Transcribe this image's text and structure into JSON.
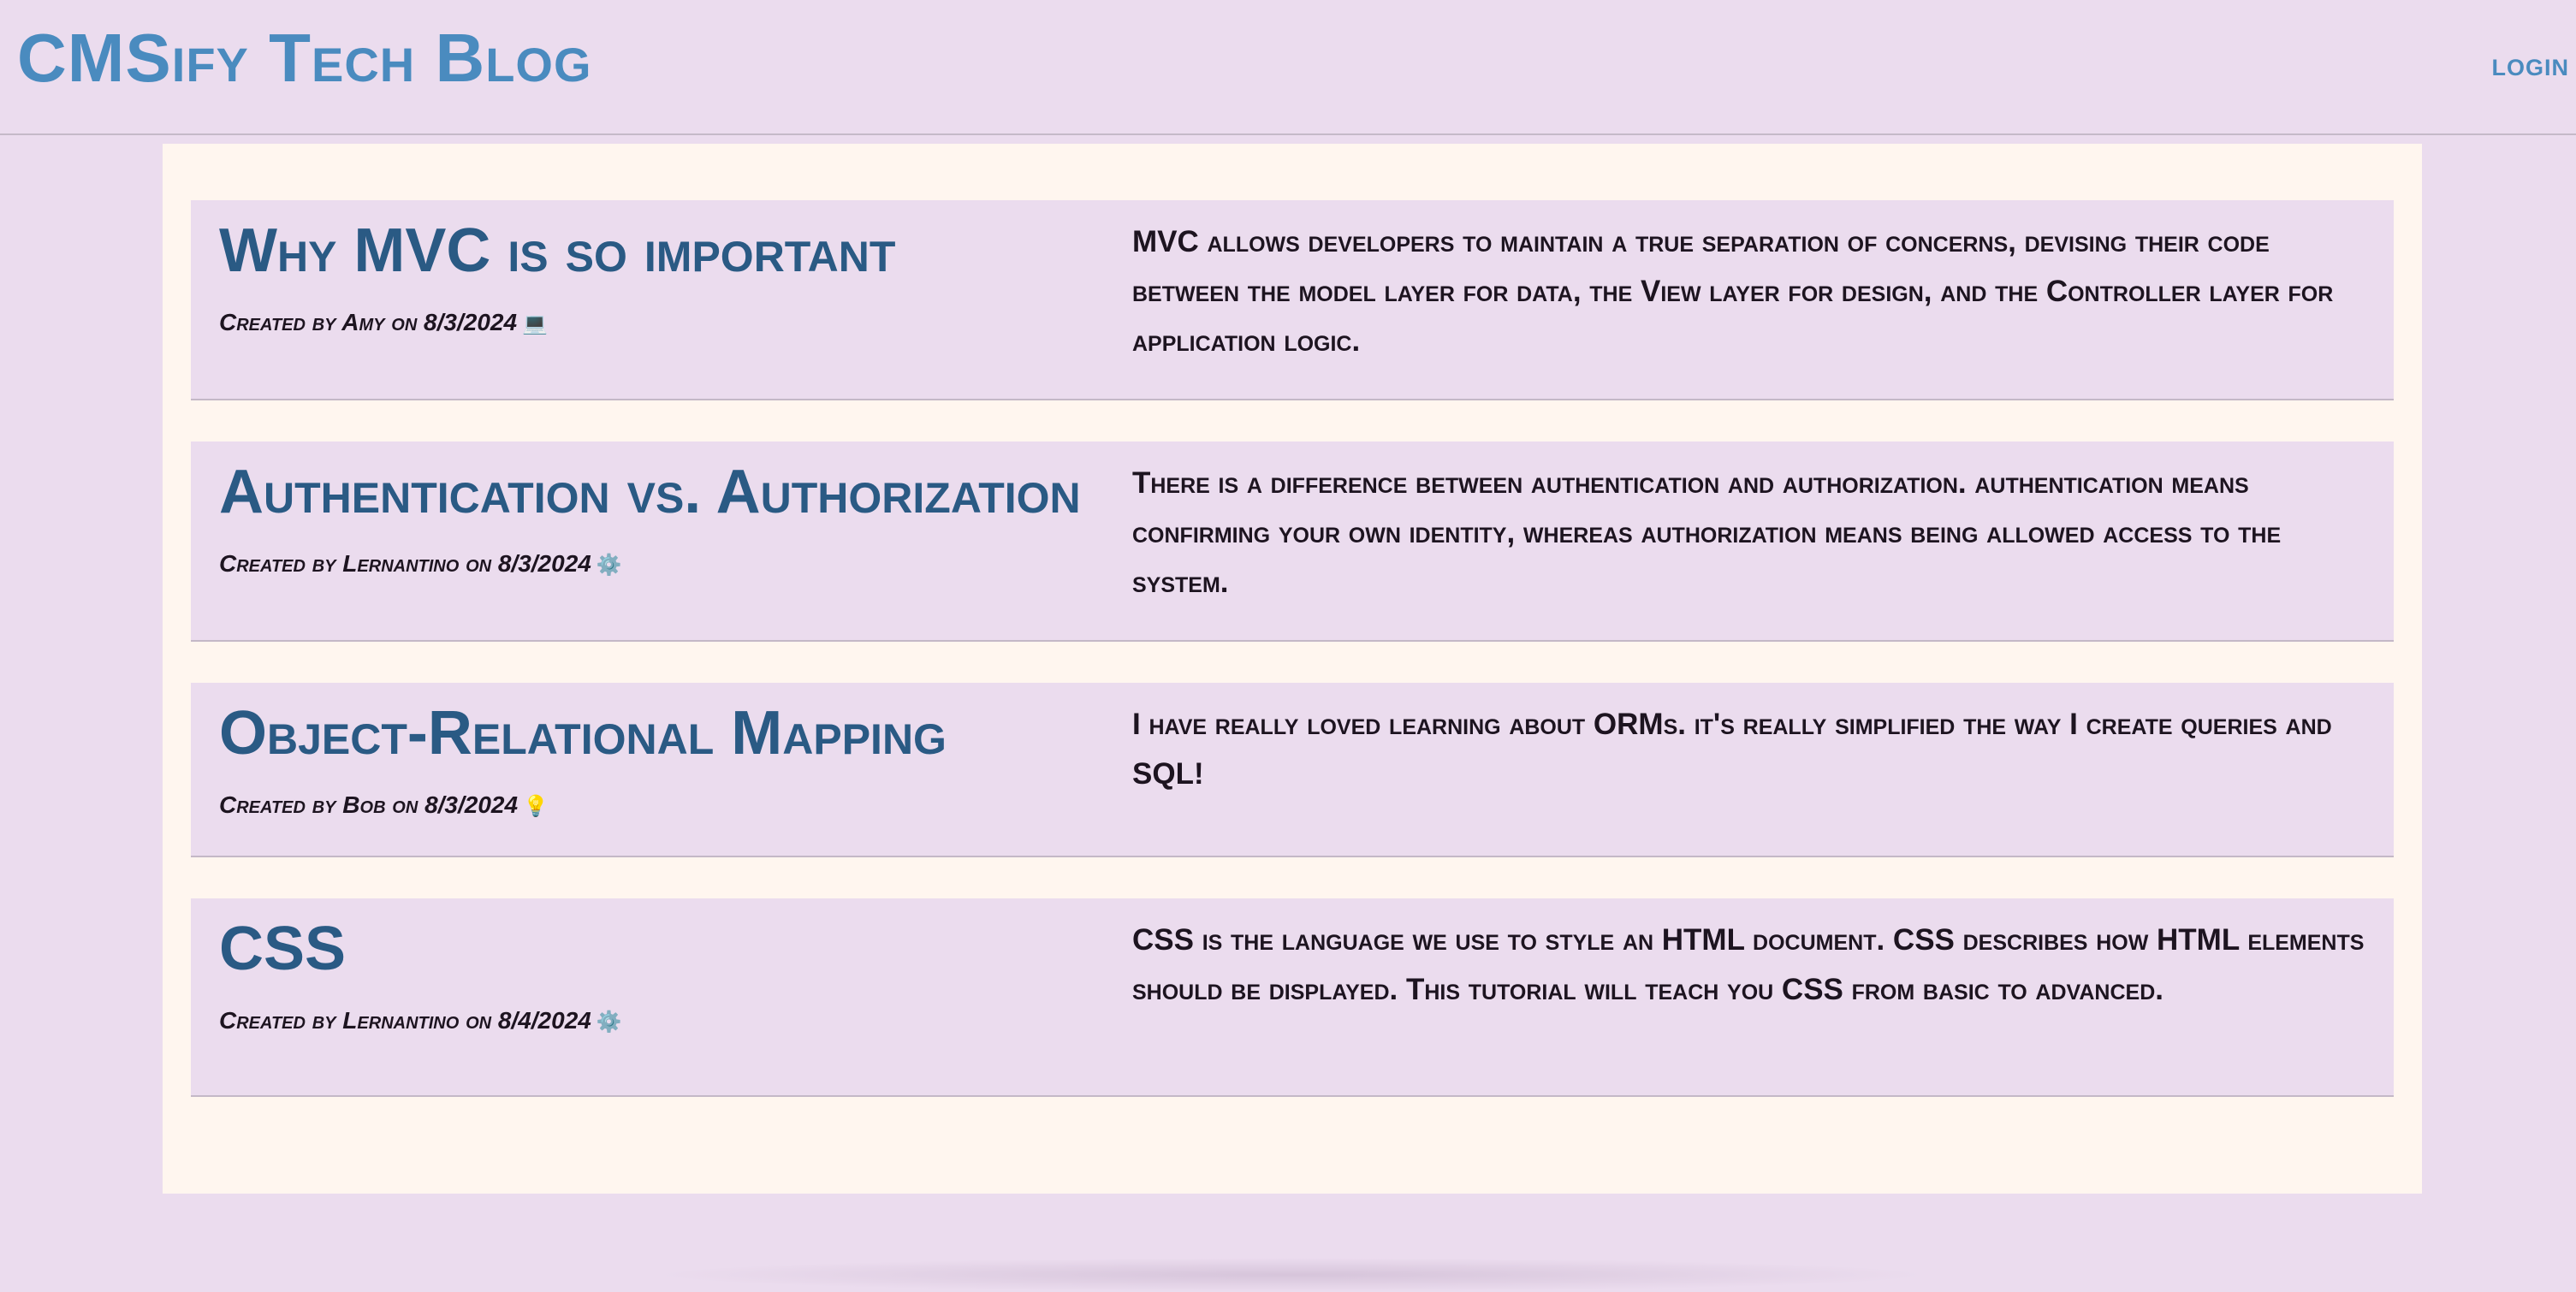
{
  "header": {
    "site_title": "CMSify Tech Blog",
    "login_label": "LOGIN"
  },
  "posts": [
    {
      "title": "Why MVC is so important",
      "meta": "Created by Amy on 8/3/2024",
      "emoji": "💻",
      "body": "MVC allows developers to maintain a true separation of concerns, devising their code between the model layer for data, the View layer for design, and the Controller layer for application logic."
    },
    {
      "title": "Authentication vs. Authorization",
      "meta": "Created by Lernantino on 8/3/2024",
      "emoji": "⚙️",
      "body": "There is a difference between authentication and authorization. authentication means confirming your own identity, whereas authorization means being allowed access to the system."
    },
    {
      "title": "Object-Relational Mapping",
      "meta": "Created by Bob on 8/3/2024",
      "emoji": "💡",
      "body": "I have really loved learning about ORMs. it's really simplified the way I create queries and SQL!"
    },
    {
      "title": "CSS",
      "meta": "Created by Lernantino on 8/4/2024",
      "emoji": "⚙️",
      "body": "CSS is the language we use to style an HTML document. CSS describes how HTML elements should be displayed. This tutorial will teach you CSS from basic to advanced."
    }
  ]
}
